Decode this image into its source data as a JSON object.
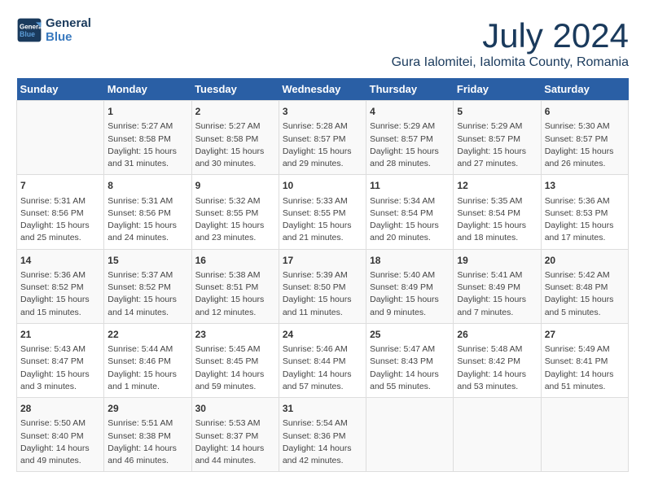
{
  "logo": {
    "line1": "General",
    "line2": "Blue"
  },
  "title": "July 2024",
  "subtitle": "Gura Ialomitei, Ialomita County, Romania",
  "days_header": [
    "Sunday",
    "Monday",
    "Tuesday",
    "Wednesday",
    "Thursday",
    "Friday",
    "Saturday"
  ],
  "weeks": [
    [
      {
        "num": "",
        "info": ""
      },
      {
        "num": "1",
        "info": "Sunrise: 5:27 AM\nSunset: 8:58 PM\nDaylight: 15 hours\nand 31 minutes."
      },
      {
        "num": "2",
        "info": "Sunrise: 5:27 AM\nSunset: 8:58 PM\nDaylight: 15 hours\nand 30 minutes."
      },
      {
        "num": "3",
        "info": "Sunrise: 5:28 AM\nSunset: 8:57 PM\nDaylight: 15 hours\nand 29 minutes."
      },
      {
        "num": "4",
        "info": "Sunrise: 5:29 AM\nSunset: 8:57 PM\nDaylight: 15 hours\nand 28 minutes."
      },
      {
        "num": "5",
        "info": "Sunrise: 5:29 AM\nSunset: 8:57 PM\nDaylight: 15 hours\nand 27 minutes."
      },
      {
        "num": "6",
        "info": "Sunrise: 5:30 AM\nSunset: 8:57 PM\nDaylight: 15 hours\nand 26 minutes."
      }
    ],
    [
      {
        "num": "7",
        "info": "Sunrise: 5:31 AM\nSunset: 8:56 PM\nDaylight: 15 hours\nand 25 minutes."
      },
      {
        "num": "8",
        "info": "Sunrise: 5:31 AM\nSunset: 8:56 PM\nDaylight: 15 hours\nand 24 minutes."
      },
      {
        "num": "9",
        "info": "Sunrise: 5:32 AM\nSunset: 8:55 PM\nDaylight: 15 hours\nand 23 minutes."
      },
      {
        "num": "10",
        "info": "Sunrise: 5:33 AM\nSunset: 8:55 PM\nDaylight: 15 hours\nand 21 minutes."
      },
      {
        "num": "11",
        "info": "Sunrise: 5:34 AM\nSunset: 8:54 PM\nDaylight: 15 hours\nand 20 minutes."
      },
      {
        "num": "12",
        "info": "Sunrise: 5:35 AM\nSunset: 8:54 PM\nDaylight: 15 hours\nand 18 minutes."
      },
      {
        "num": "13",
        "info": "Sunrise: 5:36 AM\nSunset: 8:53 PM\nDaylight: 15 hours\nand 17 minutes."
      }
    ],
    [
      {
        "num": "14",
        "info": "Sunrise: 5:36 AM\nSunset: 8:52 PM\nDaylight: 15 hours\nand 15 minutes."
      },
      {
        "num": "15",
        "info": "Sunrise: 5:37 AM\nSunset: 8:52 PM\nDaylight: 15 hours\nand 14 minutes."
      },
      {
        "num": "16",
        "info": "Sunrise: 5:38 AM\nSunset: 8:51 PM\nDaylight: 15 hours\nand 12 minutes."
      },
      {
        "num": "17",
        "info": "Sunrise: 5:39 AM\nSunset: 8:50 PM\nDaylight: 15 hours\nand 11 minutes."
      },
      {
        "num": "18",
        "info": "Sunrise: 5:40 AM\nSunset: 8:49 PM\nDaylight: 15 hours\nand 9 minutes."
      },
      {
        "num": "19",
        "info": "Sunrise: 5:41 AM\nSunset: 8:49 PM\nDaylight: 15 hours\nand 7 minutes."
      },
      {
        "num": "20",
        "info": "Sunrise: 5:42 AM\nSunset: 8:48 PM\nDaylight: 15 hours\nand 5 minutes."
      }
    ],
    [
      {
        "num": "21",
        "info": "Sunrise: 5:43 AM\nSunset: 8:47 PM\nDaylight: 15 hours\nand 3 minutes."
      },
      {
        "num": "22",
        "info": "Sunrise: 5:44 AM\nSunset: 8:46 PM\nDaylight: 15 hours\nand 1 minute."
      },
      {
        "num": "23",
        "info": "Sunrise: 5:45 AM\nSunset: 8:45 PM\nDaylight: 14 hours\nand 59 minutes."
      },
      {
        "num": "24",
        "info": "Sunrise: 5:46 AM\nSunset: 8:44 PM\nDaylight: 14 hours\nand 57 minutes."
      },
      {
        "num": "25",
        "info": "Sunrise: 5:47 AM\nSunset: 8:43 PM\nDaylight: 14 hours\nand 55 minutes."
      },
      {
        "num": "26",
        "info": "Sunrise: 5:48 AM\nSunset: 8:42 PM\nDaylight: 14 hours\nand 53 minutes."
      },
      {
        "num": "27",
        "info": "Sunrise: 5:49 AM\nSunset: 8:41 PM\nDaylight: 14 hours\nand 51 minutes."
      }
    ],
    [
      {
        "num": "28",
        "info": "Sunrise: 5:50 AM\nSunset: 8:40 PM\nDaylight: 14 hours\nand 49 minutes."
      },
      {
        "num": "29",
        "info": "Sunrise: 5:51 AM\nSunset: 8:38 PM\nDaylight: 14 hours\nand 46 minutes."
      },
      {
        "num": "30",
        "info": "Sunrise: 5:53 AM\nSunset: 8:37 PM\nDaylight: 14 hours\nand 44 minutes."
      },
      {
        "num": "31",
        "info": "Sunrise: 5:54 AM\nSunset: 8:36 PM\nDaylight: 14 hours\nand 42 minutes."
      },
      {
        "num": "",
        "info": ""
      },
      {
        "num": "",
        "info": ""
      },
      {
        "num": "",
        "info": ""
      }
    ]
  ]
}
